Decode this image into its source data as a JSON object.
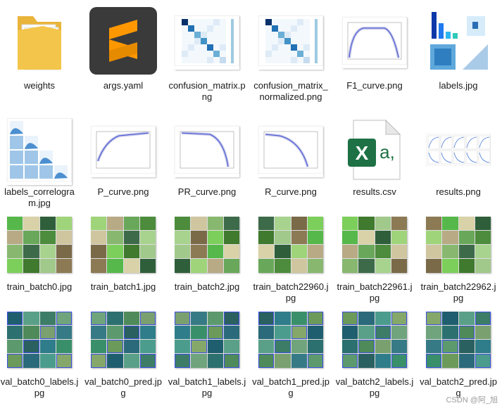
{
  "files": [
    {
      "name": "weights",
      "type": "folder"
    },
    {
      "name": "args.yaml",
      "type": "sublime"
    },
    {
      "name": "confusion_matrix.png",
      "type": "confusion"
    },
    {
      "name": "confusion_matrix_normalized.png",
      "type": "confusion"
    },
    {
      "name": "F1_curve.png",
      "type": "curve-f1"
    },
    {
      "name": "labels.jpg",
      "type": "labels"
    },
    {
      "name": "labels_correlogram.jpg",
      "type": "correlogram"
    },
    {
      "name": "P_curve.png",
      "type": "curve-p"
    },
    {
      "name": "PR_curve.png",
      "type": "curve-pr"
    },
    {
      "name": "R_curve.png",
      "type": "curve-r"
    },
    {
      "name": "results.csv",
      "type": "excel"
    },
    {
      "name": "results.png",
      "type": "results"
    },
    {
      "name": "train_batch0.jpg",
      "type": "mosaic-train"
    },
    {
      "name": "train_batch1.jpg",
      "type": "mosaic-train"
    },
    {
      "name": "train_batch2.jpg",
      "type": "mosaic-train"
    },
    {
      "name": "train_batch22960.jpg",
      "type": "mosaic-train"
    },
    {
      "name": "train_batch22961.jpg",
      "type": "mosaic-train"
    },
    {
      "name": "train_batch22962.jpg",
      "type": "mosaic-train"
    },
    {
      "name": "val_batch0_labels.jpg",
      "type": "mosaic-val"
    },
    {
      "name": "val_batch0_pred.jpg",
      "type": "mosaic-val"
    },
    {
      "name": "val_batch1_labels.jpg",
      "type": "mosaic-val"
    },
    {
      "name": "val_batch1_pred.jpg",
      "type": "mosaic-val"
    },
    {
      "name": "val_batch2_labels.jpg",
      "type": "mosaic-val"
    },
    {
      "name": "val_batch2_pred.jpg",
      "type": "mosaic-val"
    }
  ],
  "watermark": "CSDN @阿_旭",
  "colors": {
    "folder": "#f3c54a",
    "sublime_bg": "#3a3a3a",
    "sublime_accent": "#ff9800",
    "excel": "#1e7145"
  }
}
